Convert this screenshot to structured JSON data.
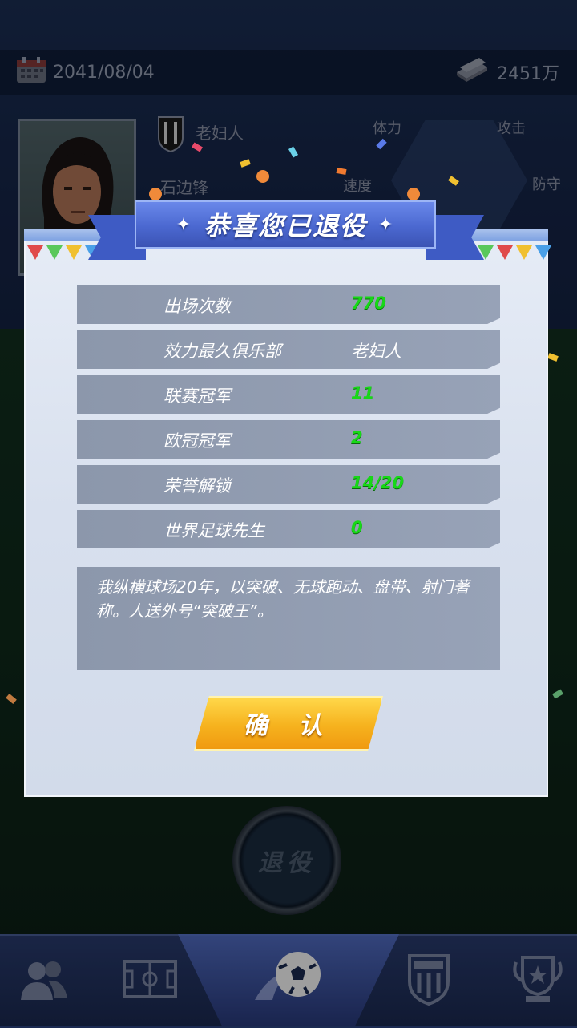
{
  "header": {
    "date": "2041/08/04",
    "money": "2451万"
  },
  "player": {
    "club": "老妇人",
    "position": "石边锋",
    "stats": [
      "体力",
      "攻击",
      "速度",
      "防守"
    ]
  },
  "retire_button": "退役",
  "dialog": {
    "title": "恭喜您已退役",
    "rows": [
      {
        "label": "出场次数",
        "value": "770",
        "color": "green"
      },
      {
        "label": "效力最久俱乐部",
        "value": "老妇人",
        "color": "white"
      },
      {
        "label": "联赛冠军",
        "value": "11",
        "color": "green"
      },
      {
        "label": "欧冠冠军",
        "value": "2",
        "color": "green"
      },
      {
        "label": "荣誉解锁",
        "value": "14/20",
        "color": "green"
      },
      {
        "label": "世界足球先生",
        "value": "0",
        "color": "green"
      }
    ],
    "quote": "我纵横球场20年，以突破、无球跑动、盘带、射门著称。人送外号“突破王”。",
    "confirm_label": "确 认"
  },
  "nav": {
    "items": [
      "team-icon",
      "pitch-icon",
      "match-icon",
      "club-badge-icon",
      "trophy-icon"
    ],
    "active": "match-icon"
  },
  "colors": {
    "value_green": "#18d818",
    "ribbon_blue": "#4b68d0",
    "confirm_gold": "#f6b21e"
  }
}
